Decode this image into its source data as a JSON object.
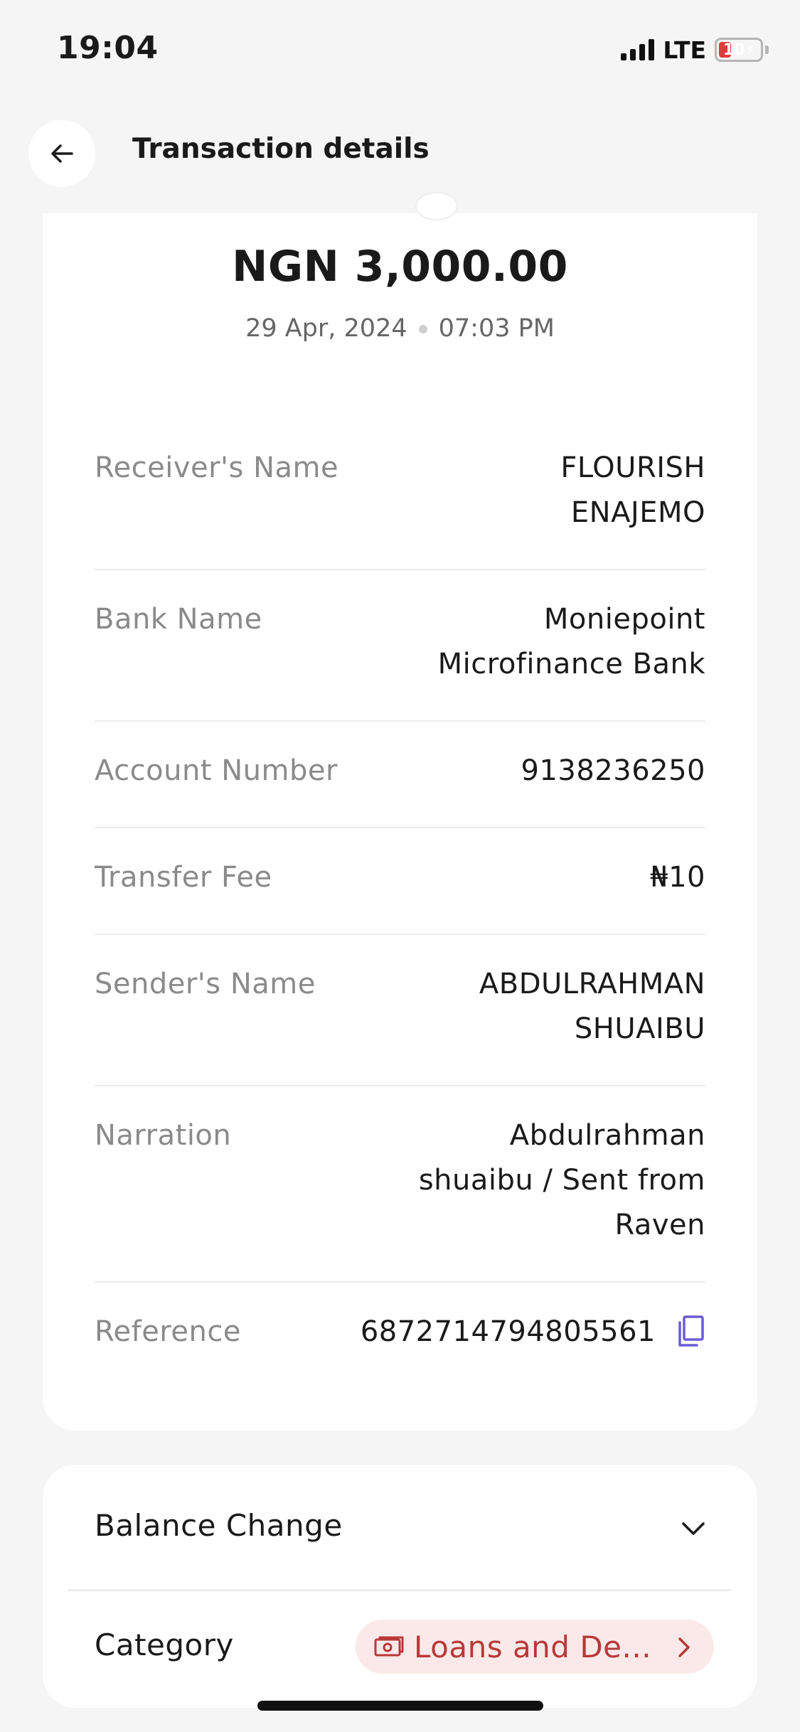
{
  "status_bar": {
    "time": "19:04",
    "network": "LTE",
    "battery": "10"
  },
  "header": {
    "title": "Transaction details"
  },
  "transaction": {
    "amount": "NGN 3,000.00",
    "date": "29 Apr, 2024",
    "time": "07:03 PM"
  },
  "details": {
    "receiver_name": {
      "label": "Receiver's Name",
      "line1": "FLOURISH",
      "line2": "ENAJEMO"
    },
    "bank_name": {
      "label": "Bank Name",
      "line1": "Moniepoint",
      "line2": "Microfinance Bank"
    },
    "account_number": {
      "label": "Account Number",
      "value": "9138236250"
    },
    "transfer_fee": {
      "label": "Transfer Fee",
      "value": "₦10"
    },
    "sender_name": {
      "label": "Sender's Name",
      "line1": "ABDULRAHMAN",
      "line2": "SHUAIBU"
    },
    "narration": {
      "label": "Narration",
      "line1": "Abdulrahman",
      "line2": "shuaibu / Sent from",
      "line3": "Raven"
    },
    "reference": {
      "label": "Reference",
      "value": "6872714794805561"
    }
  },
  "balance_change": {
    "label": "Balance Change"
  },
  "category": {
    "label": "Category",
    "value": "Loans and De..."
  },
  "colors": {
    "accent_copy": "#6a5bd6",
    "category_text": "#b83838",
    "category_bg": "#fbe9e9",
    "battery_low": "#e03b3b"
  }
}
